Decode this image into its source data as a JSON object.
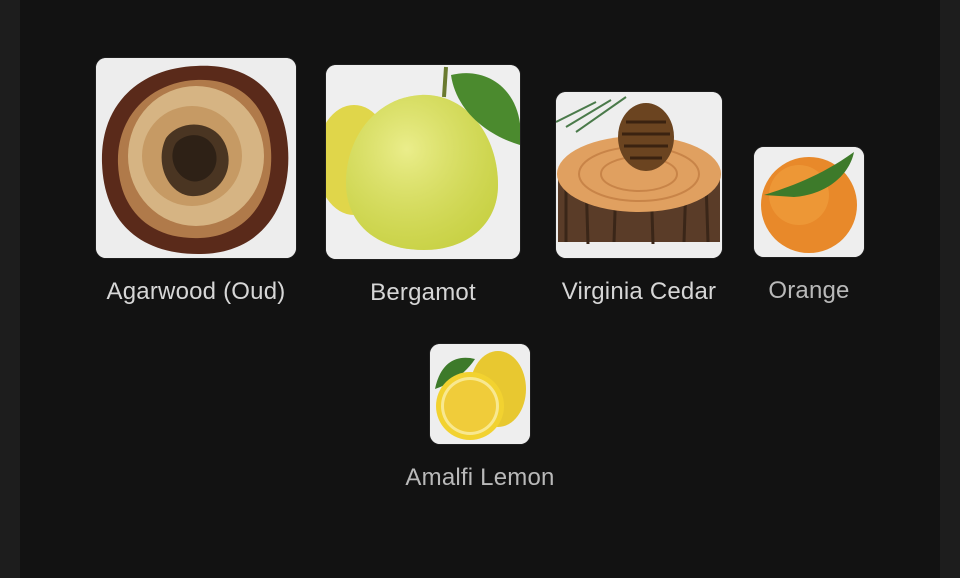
{
  "notes": [
    {
      "label": "Agarwood (Oud)",
      "icon": "agarwood-image"
    },
    {
      "label": "Bergamot",
      "icon": "bergamot-image"
    },
    {
      "label": "Virginia Cedar",
      "icon": "cedar-image"
    },
    {
      "label": "Orange",
      "icon": "orange-image"
    },
    {
      "label": "Amalfi Lemon",
      "icon": "lemon-image"
    }
  ],
  "colors": {
    "background": "#121212",
    "label": "#d6d6d6",
    "tile": "#ececec"
  }
}
